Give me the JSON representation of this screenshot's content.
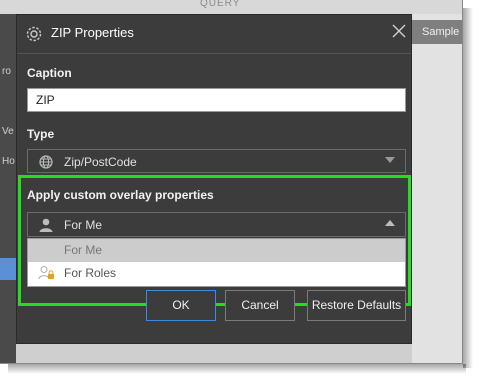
{
  "background": {
    "query_label": "QUERY",
    "sample_tab": "Sample"
  },
  "dialog": {
    "title": "ZIP Properties",
    "title_icon": "gear-icon",
    "close_icon": "close-icon",
    "caption": {
      "label": "Caption",
      "value": "ZIP"
    },
    "type": {
      "label": "Type",
      "selected": "Zip/PostCode",
      "icon": "globe-icon"
    },
    "overlay": {
      "label": "Apply custom overlay properties",
      "selected": "For Me",
      "icon": "user-icon",
      "options": [
        {
          "label": "For Me",
          "icon": "user-icon",
          "selected": true
        },
        {
          "label": "For Roles",
          "icon": "user-lock-icon",
          "selected": false
        }
      ]
    },
    "buttons": {
      "ok": "OK",
      "cancel": "Cancel",
      "restore": "Restore Defaults"
    }
  },
  "colors": {
    "highlight": "#22dd22",
    "dialog_bg": "#3c3c3c",
    "ok_border": "#3f8be0"
  }
}
